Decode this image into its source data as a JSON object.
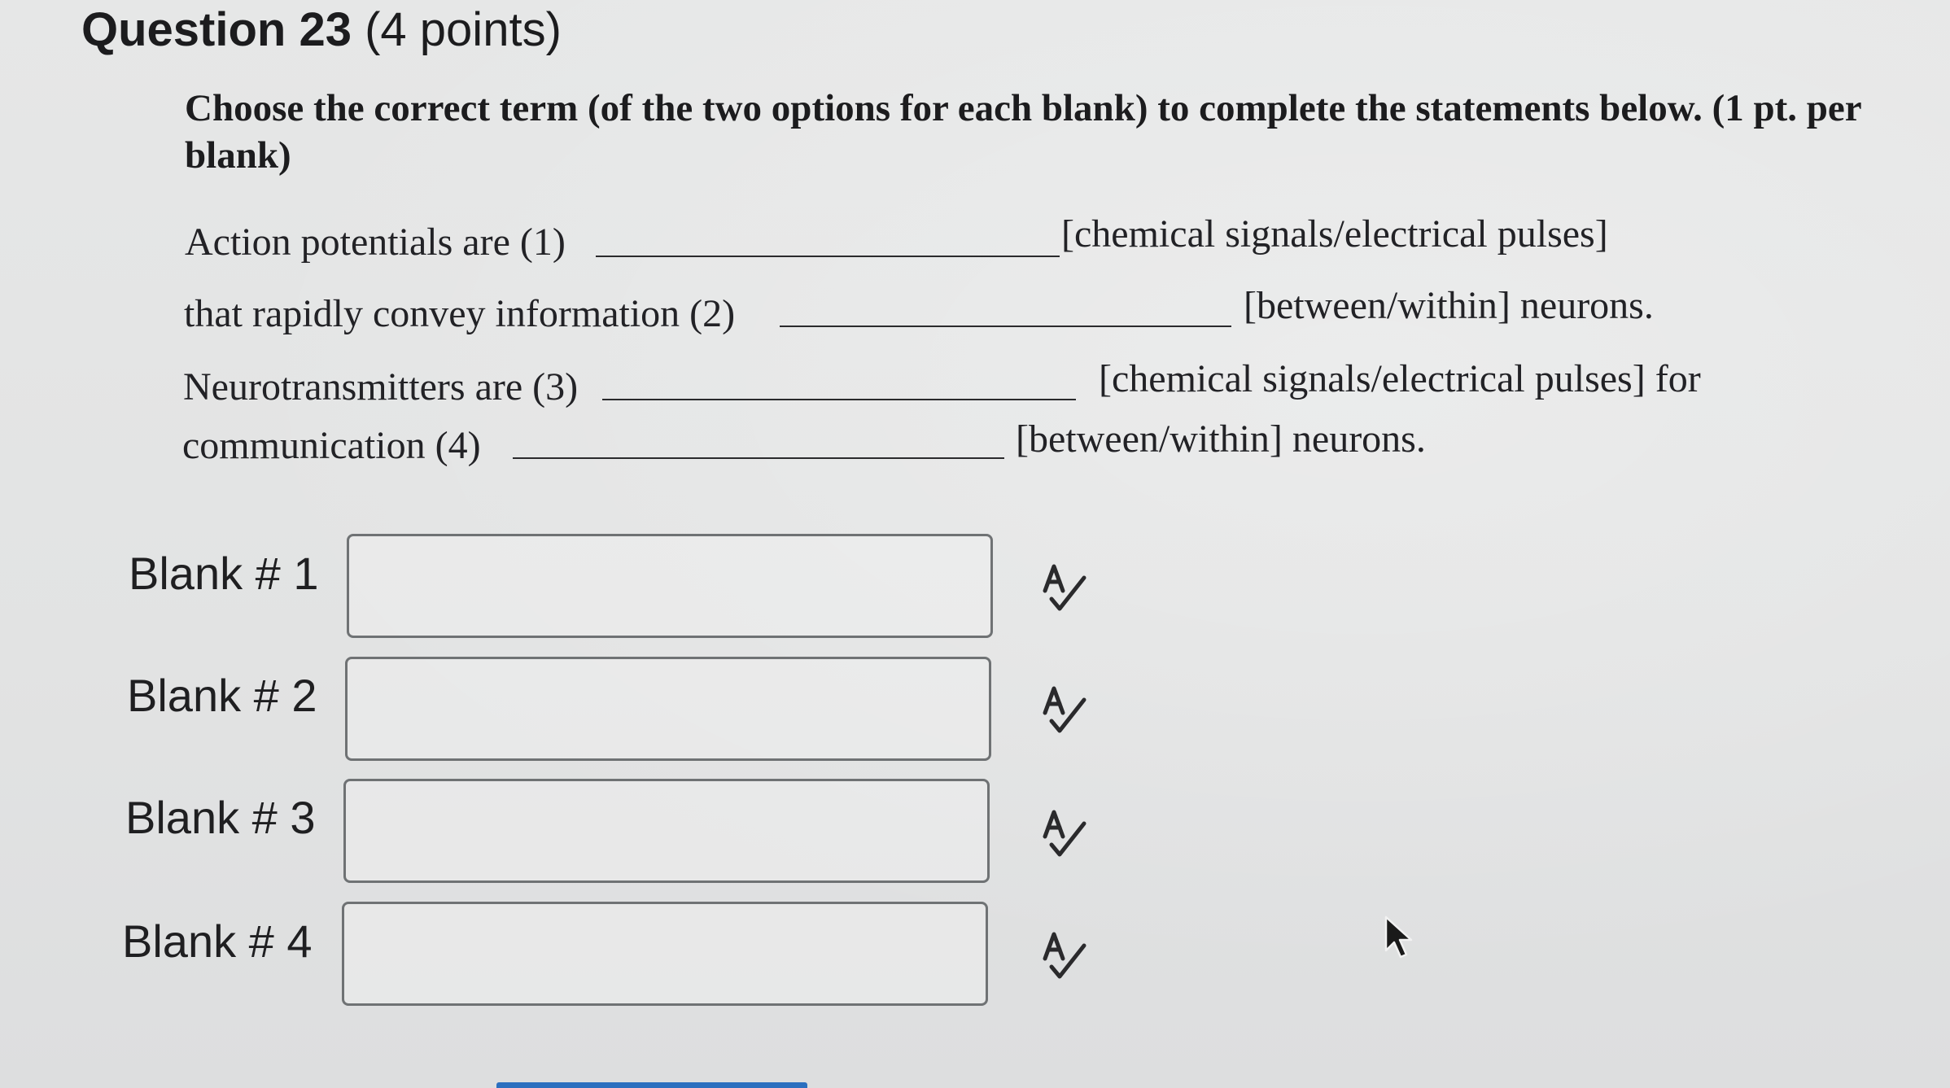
{
  "question": {
    "title": "Question 23",
    "points": "(4 points)",
    "instructions": "Choose the correct term (of the two options for each blank) to complete the statements below. (1 pt. per blank)"
  },
  "statements": [
    {
      "prefix": "Action potentials are (1)",
      "options": "[chemical signals/electrical pulses]"
    },
    {
      "prefix": "that rapidly convey information (2)",
      "options": "[between/within] neurons."
    },
    {
      "prefix": "Neurotransmitters are (3)",
      "options": "[chemical signals/electrical pulses] for"
    },
    {
      "prefix": "communication (4)",
      "options": "[between/within] neurons."
    }
  ],
  "blanks": [
    {
      "label": "Blank # 1",
      "value": "",
      "icon": "spellcheck-icon"
    },
    {
      "label": "Blank # 2",
      "value": "",
      "icon": "spellcheck-icon"
    },
    {
      "label": "Blank # 3",
      "value": "",
      "icon": "spellcheck-icon"
    },
    {
      "label": "Blank # 4",
      "value": "",
      "icon": "spellcheck-icon"
    }
  ],
  "colors": {
    "background": "#e3e4e4",
    "text": "#1f1f21",
    "input_border": "#6f7274",
    "accent": "#2b6fbf"
  }
}
